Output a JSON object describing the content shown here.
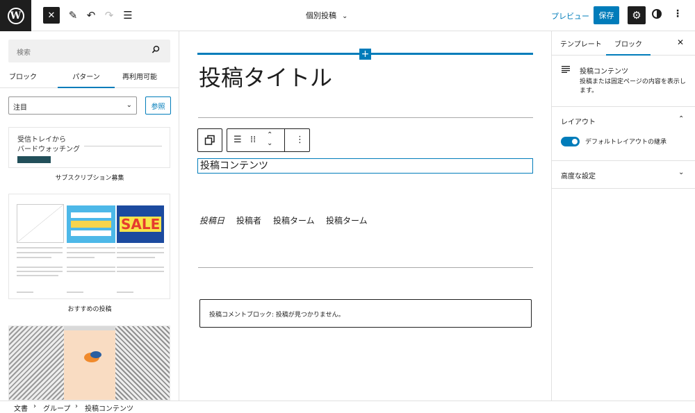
{
  "topbar": {
    "logo_letter": "W",
    "close_glyph": "✕",
    "pen_glyph": "✎",
    "undo_glyph": "↶",
    "redo_glyph": "↷",
    "list_glyph": "☰",
    "doc_title": "個別投稿",
    "preview": "プレビュー",
    "save": "保存",
    "settings_glyph": "⚙",
    "kebab": "⋮"
  },
  "left": {
    "search_placeholder": "検索",
    "tabs": [
      "ブロック",
      "パターン",
      "再利用可能"
    ],
    "select_value": "注目",
    "browse": "参照",
    "card1": {
      "line1": "受信トレイから",
      "line2": "バードウォッチング",
      "caption": "サブスクリプション募集"
    },
    "card2": {
      "caption": "おすすめの投稿",
      "sale": "SALE"
    }
  },
  "canvas": {
    "plus": "+",
    "post_title": "投稿タイトル",
    "post_content": "投稿コンテンツ",
    "meta": [
      "投稿日",
      "投稿者",
      "投稿ターム",
      "投稿ターム"
    ],
    "comment": "投稿コメントブロック: 投稿が見つかりません。"
  },
  "right": {
    "tabs": [
      "テンプレート",
      "ブロック"
    ],
    "close": "✕",
    "block_name": "投稿コンテンツ",
    "block_desc": "投稿または固定ページの内容を表示します。",
    "layout": "レイアウト",
    "toggle_label": "デフォルトレイアウトの継承",
    "advanced": "高度な設定"
  },
  "breadcrumb": [
    "文書",
    "グループ",
    "投稿コンテンツ"
  ],
  "colors": {
    "accent": "#007cba",
    "dark": "#1e1e1e"
  }
}
